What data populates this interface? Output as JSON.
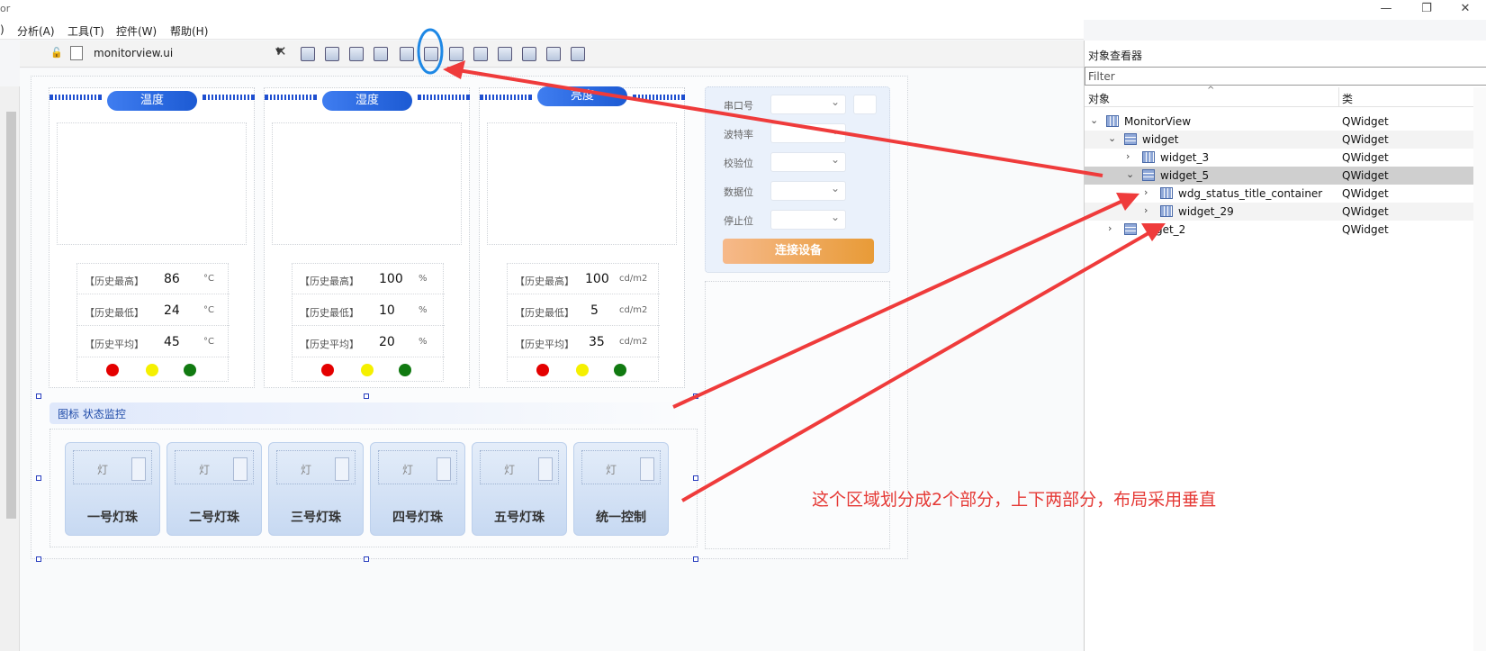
{
  "titlebar": {
    "app_fragment": "or",
    "minimize": "—",
    "restore": "❐",
    "close": "✕"
  },
  "menu": [
    ")",
    "分析(A)",
    "工具(T)",
    "控件(W)",
    "帮助(H)"
  ],
  "toolbar": {
    "file_name": "monitorview.ui"
  },
  "cards": [
    {
      "title": "温度",
      "stats": [
        {
          "label": "【历史最高】",
          "value": "86",
          "unit": "°C"
        },
        {
          "label": "【历史最低】",
          "value": "24",
          "unit": "°C"
        },
        {
          "label": "【历史平均】",
          "value": "45",
          "unit": "°C"
        }
      ]
    },
    {
      "title": "湿度",
      "stats": [
        {
          "label": "【历史最高】",
          "value": "100",
          "unit": "%"
        },
        {
          "label": "【历史最低】",
          "value": "10",
          "unit": "%"
        },
        {
          "label": "【历史平均】",
          "value": "20",
          "unit": "%"
        }
      ]
    },
    {
      "title": "亮度",
      "stats": [
        {
          "label": "【历史最高】",
          "value": "100",
          "unit": "cd/m2"
        },
        {
          "label": "【历史最低】",
          "value": "5",
          "unit": "cd/m2"
        },
        {
          "label": "【历史平均】",
          "value": "35",
          "unit": "cd/m2"
        }
      ]
    }
  ],
  "status_colors": {
    "red": "#e40000",
    "yellow": "#f5f000",
    "green": "#117a11"
  },
  "section_title": "图标 状态监控",
  "lamp_glyph": "灯",
  "lamps": [
    "一号灯珠",
    "二号灯珠",
    "三号灯珠",
    "四号灯珠",
    "五号灯珠",
    "统一控制"
  ],
  "serial": {
    "labels": [
      "串口号",
      "波特率",
      "校验位",
      "数据位",
      "停止位"
    ],
    "connect": "连接设备"
  },
  "object_inspector": {
    "title": "对象查看器",
    "filter_placeholder": "Filter",
    "col_object": "对象",
    "col_class": "类",
    "rows": [
      {
        "name": "MonitorView",
        "class": "QWidget"
      },
      {
        "name": "widget",
        "class": "QWidget"
      },
      {
        "name": "widget_3",
        "class": "QWidget"
      },
      {
        "name": "widget_5",
        "class": "QWidget"
      },
      {
        "name": "wdg_status_title_container",
        "class": "QWidget"
      },
      {
        "name": "widget_29",
        "class": "QWidget"
      },
      {
        "name": "idget_2",
        "class": "QWidget"
      }
    ]
  },
  "annotation": "这个区域划分成2个部分，上下两部分，布局采用垂直",
  "accent_colors": {
    "arrow": "#ef3b3b",
    "circle": "#1e88e5",
    "pill": "#1c5ad3",
    "button": "#e89b37"
  }
}
